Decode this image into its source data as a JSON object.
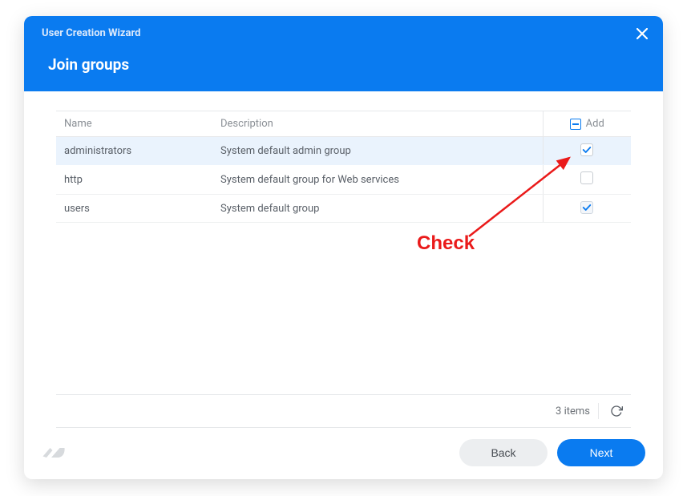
{
  "header": {
    "wizard_title": "User Creation Wizard",
    "page_heading": "Join groups"
  },
  "table": {
    "columns": {
      "name": "Name",
      "description": "Description",
      "add": "Add"
    },
    "rows": [
      {
        "name": "administrators",
        "description": "System default admin group",
        "checked": true,
        "selected": true,
        "disabled": false
      },
      {
        "name": "http",
        "description": "System default group for Web services",
        "checked": false,
        "selected": false,
        "disabled": false
      },
      {
        "name": "users",
        "description": "System default group",
        "checked": true,
        "selected": false,
        "disabled": true
      }
    ]
  },
  "status": {
    "item_count": "3 items"
  },
  "footer": {
    "back_label": "Back",
    "next_label": "Next"
  },
  "annotation": {
    "label": "Check"
  }
}
